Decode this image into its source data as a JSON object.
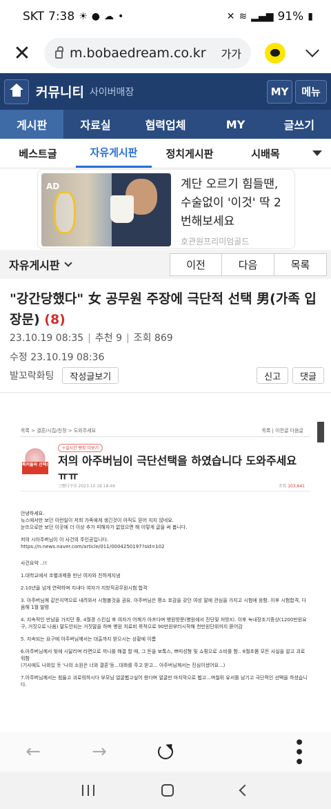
{
  "status_bar": {
    "carrier": "SKT",
    "time": "7:38",
    "battery": "91%"
  },
  "browser": {
    "url": "m.bobaedream.co.kr",
    "text_size_label": "가가"
  },
  "site_header": {
    "title": "커뮤니티",
    "subtitle": "사이버매장",
    "my_label": "MY",
    "menu_label": "메뉴"
  },
  "main_nav": [
    "게시판",
    "자료실",
    "협력업체",
    "MY",
    "글쓰기"
  ],
  "sub_nav": [
    "베스트글",
    "자유게시판",
    "정치게시판",
    "시배목"
  ],
  "ad": {
    "tag": "AD",
    "headline": "계단 오르기 힘들땐, 수술없이 '이것' 딱 2번해보세요",
    "source": "호관원프리미엄골드"
  },
  "board_bar": {
    "name": "자유게시판",
    "prev": "이전",
    "next": "다음",
    "list": "목록"
  },
  "post": {
    "title": "\"강간당했다\" 女 공무원 주장에 극단적 선택 男(가족 입장문)",
    "comment_count": "(8)",
    "date": "23.10.19  08:35",
    "recommend": "추천 9",
    "views": "조회 869",
    "modified": "수정 23.10.19  08:36",
    "author": "발꼬락화팅",
    "view_posts_button": "작성글보기",
    "report_button": "신고",
    "reply_button": "댓글"
  },
  "embedded": {
    "breadcrumb": "목록 > 결혼/시집/친정 > 도와주세요",
    "nav_right": "목록 | 이전글 다음글",
    "hot_badge": "+실시간 랭킹 더보기",
    "badge_text": "톡커들의 선택!",
    "title": "저의 아주버님이 극단선택을 하였습니다 도와주세요ㅠㅠ",
    "author_date": "그랬다구요   2023.10.18 18:46",
    "views_label": "조회",
    "views_value": "103,641",
    "paragraphs": [
      "안녕하세요.\n뉴스에서만 보던 이런일이 저희 가족에게 생긴것이 아직도 믿어 지지 않네요.\n눈뜨으로만 보던 이곳에 더 이상 추가 피해자가 없었으면 해 이렇게 글을 써 봅니다.",
      "저의 시아주버님이 이 사건의 주인공입니다.\nhttps://n.news.naver.com/article/011/0004250197?sid=102",
      "사건요약 ..!!",
      "1.대학교에서 조별과제중 만난 여자와 친하게지냄",
      "2.10년을 넘게 연락하며 지내다 여자가 지방직공무원시험 합격",
      "3. 아주버님께 같은지역으로 내려와서 시험볼것을 권유. 아주버님은 평소 호감을 갖던 여성 말에 관심을 가지고 시험에 응함. 이후 시험합격, 다음해 1월 발령",
      "4. 지속적인 만남을 가지던 중, 4월경 스킨십 후 여자가 어깨가 아프다며 병원방문(병원에서 진단및 처방X). 이후 녹내장조기증상(1200만원요구, 거짓으로 나옴) 말도안되는 거짓말을 하며 병원 치료비 목적으로 90만원부터시작해 천만원단위까지 뜯어감",
      "5. 지속되는 요구에 아주버님께서는 대출까지 받으시는 상황에 이름",
      "6.아주버님께서 빚에 시달리며 라면으로 끼니를 해결 할 때, 그 돈을 보톡스, 쁘띠성형 및 쇼핑으로 소비를 함.. 8월초쯤 모든 사실을 알고 괴로워함\n(기사에도 나와있 듯 '나의 소원은 너와 결혼'등...대화를 주고 받고... 아주버님께서는 진심이셨어요...)",
      "7.아주버님께서는 힘들고 괴로워하시다 부모님 얼굴뵙고싶어 왔다며 얼굴만 마지막으로 뵙고...며칠뒤 유서를 남기고 극단적인 선택을 하셨습니다."
    ]
  },
  "icons": {
    "close": "close-icon",
    "lock": "lock-icon",
    "kakao": "kakao-talk-icon",
    "chevron": "chevron-down-icon",
    "home": "home-icon",
    "back": "arrow-left-icon",
    "forward": "arrow-right-icon",
    "reload": "reload-icon",
    "more": "more-vertical-icon"
  },
  "colors": {
    "site_header": "#1f3e6e",
    "main_nav": "#2b4c80",
    "main_nav_active": "#3e6aa6",
    "sub_nav_active": "#2a6fd6",
    "comment_count": "#d12f2f",
    "kakao": "#fee500"
  }
}
